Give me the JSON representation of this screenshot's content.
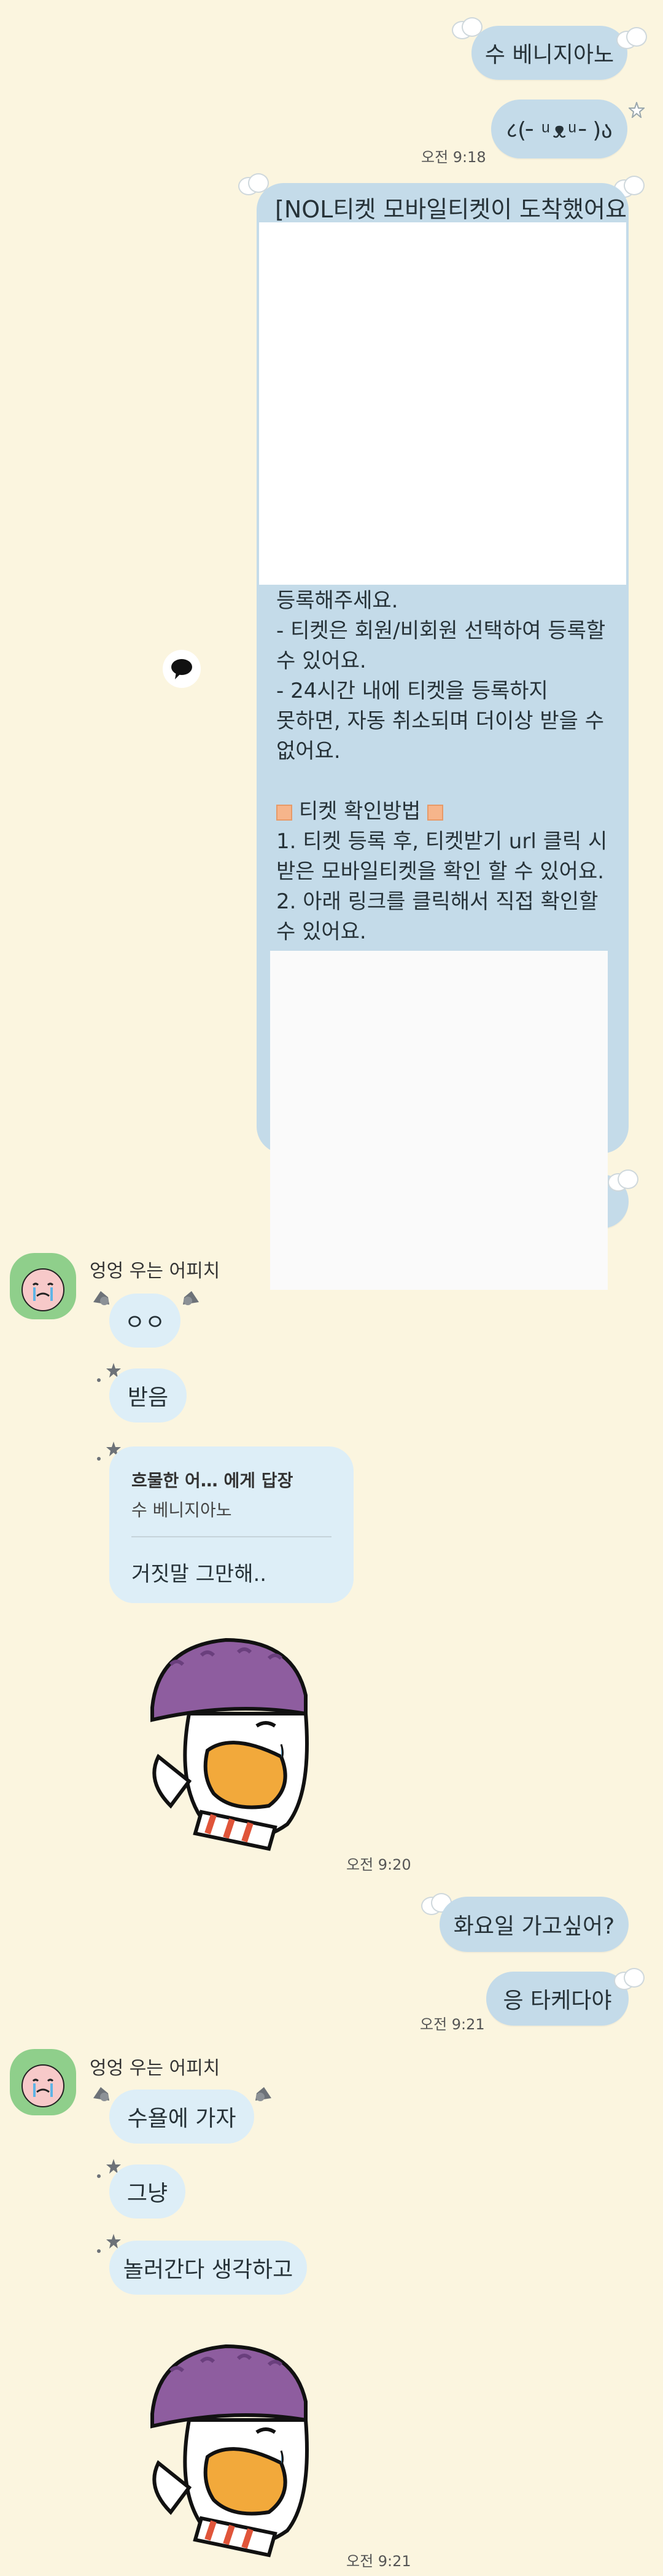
{
  "messages": {
    "m1": "수 베니지아노",
    "m2": "८(╴ ͧ ᴥ ͧ ╴)ა",
    "t1": "오전 9:18",
    "ticket": {
      "title": "[NOL티켓 모바일티켓이 도착했어요]",
      "lines": [
        "등록해주세요.",
        "- 티켓은 회원/비회원 선택하여 등록할",
        "수 있어요.",
        "- 24시간 내에 티켓을 등록하지",
        "못하면, 자동 취소되며 더이상 받을 수",
        "없어요.",
        "",
        "티켓 확인방법",
        "1. 티켓 등록 후, 티켓받기 url 클릭 시",
        "받은 모바일티켓을 확인 할 수 있어요.",
        "2. 아래 링크를 클릭해서 직접 확인할",
        "수 있어요."
      ]
    },
    "sender": "엉엉 우는 어피치",
    "o1": "ㅇㅇ",
    "o2": "받음",
    "reply": {
      "header": "흐물한 어…  에게 답장",
      "quote": "수 베니지아노",
      "message": "거짓말 그만해.."
    },
    "t2": "오전 9:20",
    "m3": "화요일 가고싶어?",
    "m4": "응 타케다야",
    "t3": "오전 9:21",
    "sender2": "엉엉 우는 어피치",
    "o3": "수욜에 가자",
    "o4": "그냥",
    "o5": "놀러간다 생각하고",
    "t4": "오전 9:21"
  },
  "colors": {
    "background": "#fbf5df",
    "my_bubble": "#c4dbe9",
    "other_bubble": "#ddeef7",
    "avatar_bg": "#8fcf8b",
    "sticker_hat": "#8e5d9f",
    "sticker_beak": "#f2a93b"
  },
  "icons": [
    "cloud-icon",
    "star-icon",
    "bat-icon",
    "speech-bubble-icon",
    "apeach-avatar",
    "crying-duck-sticker"
  ]
}
